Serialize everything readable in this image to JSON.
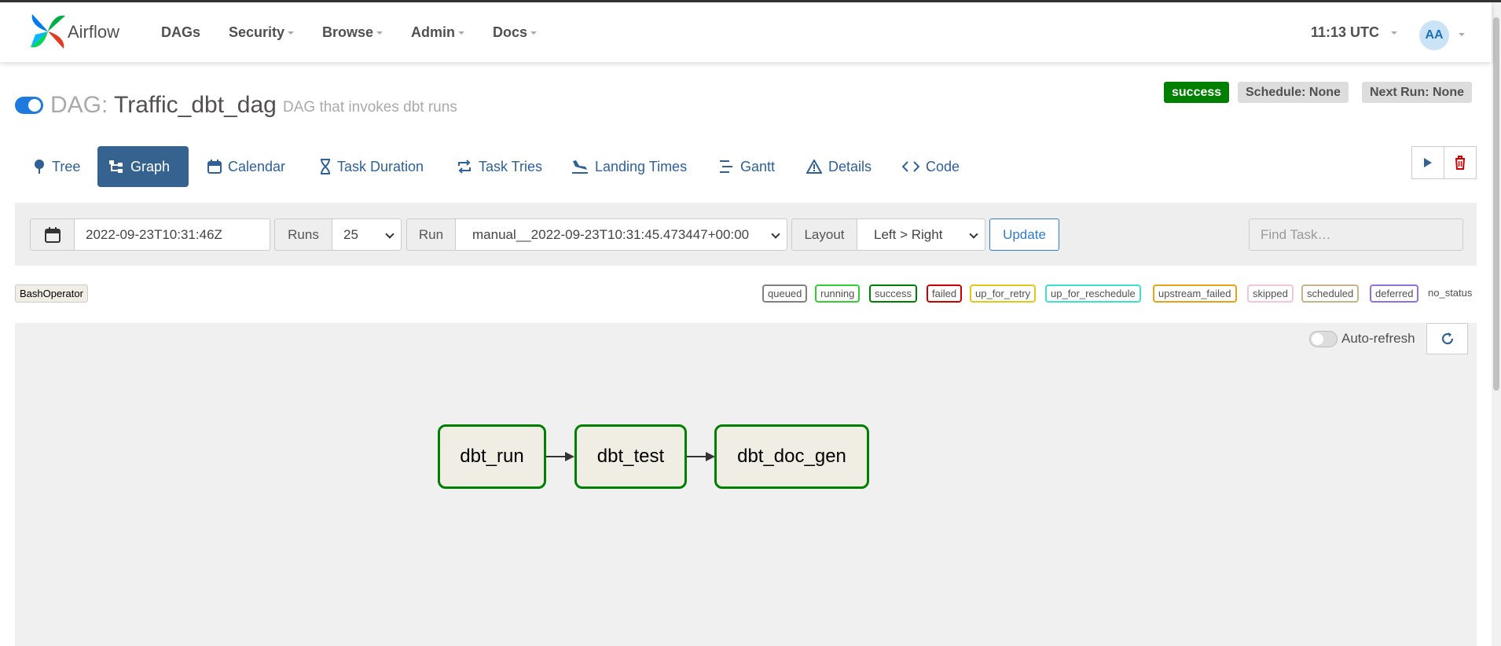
{
  "navbar": {
    "brand": "Airflow",
    "items": [
      "DAGs",
      "Security",
      "Browse",
      "Admin",
      "Docs"
    ],
    "clock": "11:13 UTC",
    "avatar": "AA"
  },
  "dag": {
    "prefix": "DAG:",
    "name": "Traffic_dbt_dag",
    "description": "DAG that invokes dbt runs",
    "status": "success",
    "schedule": "Schedule: None",
    "next_run": "Next Run: None",
    "toggle_on": true
  },
  "tabs": {
    "tree": "Tree",
    "graph": "Graph",
    "calendar": "Calendar",
    "task_duration": "Task Duration",
    "task_tries": "Task Tries",
    "landing_times": "Landing Times",
    "gantt": "Gantt",
    "details": "Details",
    "code": "Code",
    "active": "Graph"
  },
  "filters": {
    "base_date": "2022-09-23T10:31:46Z",
    "runs_label": "Runs",
    "runs_value": "25",
    "run_label": "Run",
    "run_value": "manual__2022-09-23T10:31:45.473447+00:00",
    "layout_label": "Layout",
    "layout_value": "Left > Right",
    "update_label": "Update",
    "find_placeholder": "Find Task…"
  },
  "legend": {
    "operator": "BashOperator",
    "states": {
      "queued": "queued",
      "running": "running",
      "success": "success",
      "failed": "failed",
      "up_for_retry": "up_for_retry",
      "up_for_reschedule": "up_for_reschedule",
      "upstream_failed": "upstream_failed",
      "skipped": "skipped",
      "scheduled": "scheduled",
      "deferred": "deferred",
      "no_status": "no_status"
    },
    "colors": {
      "queued": "#808080",
      "running": "#32cd32",
      "success": "#008000",
      "failed": "#cc0000",
      "up_for_retry": "#e6c619",
      "up_for_reschedule": "#40e0d0",
      "upstream_failed": "#e8a317",
      "skipped": "#f4c6d7",
      "scheduled": "#c5b587",
      "deferred": "#9370db"
    }
  },
  "graph": {
    "auto_refresh_label": "Auto-refresh",
    "auto_refresh_on": false,
    "tasks": [
      "dbt_run",
      "dbt_test",
      "dbt_doc_gen"
    ],
    "task_state": "success"
  }
}
